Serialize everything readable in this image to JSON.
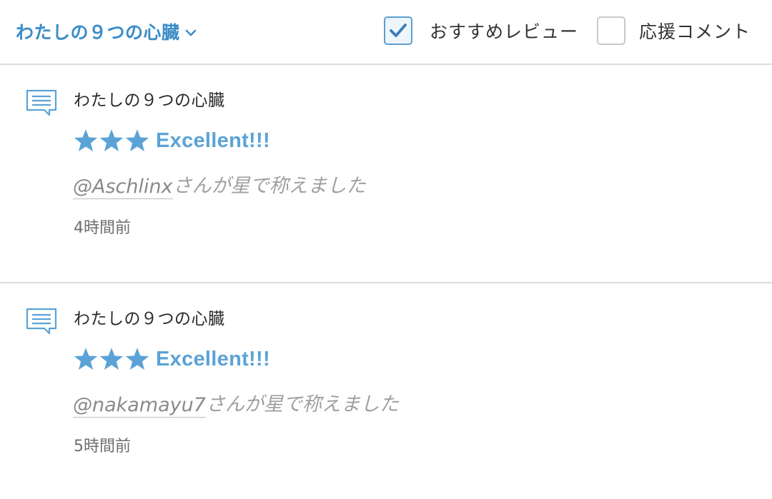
{
  "header": {
    "work_select_label": "わたしの９つの心臓",
    "filters": [
      {
        "label": "おすすめレビュー",
        "checked": true
      },
      {
        "label": "応援コメント",
        "checked": false
      }
    ]
  },
  "feed": [
    {
      "work_title": "わたしの９つの心臓",
      "stars": 3,
      "rating_text": "Excellent!!!",
      "user": "@Aschlinx",
      "praise_suffix": "さんが星で称えました",
      "time_ago": "4時間前"
    },
    {
      "work_title": "わたしの９つの心臓",
      "stars": 3,
      "rating_text": "Excellent!!!",
      "user": "@nakamayu7",
      "praise_suffix": "さんが星で称えました",
      "time_ago": "5時間前"
    }
  ],
  "colors": {
    "accent": "#3a8cc8",
    "star": "#5ba3d6",
    "divider": "#dcdcdc"
  },
  "icons": {
    "work_select": "chevron-down-icon",
    "feed_item": "comment-icon",
    "rating": "star-icon",
    "checkbox_checked": "checkmark-icon"
  }
}
